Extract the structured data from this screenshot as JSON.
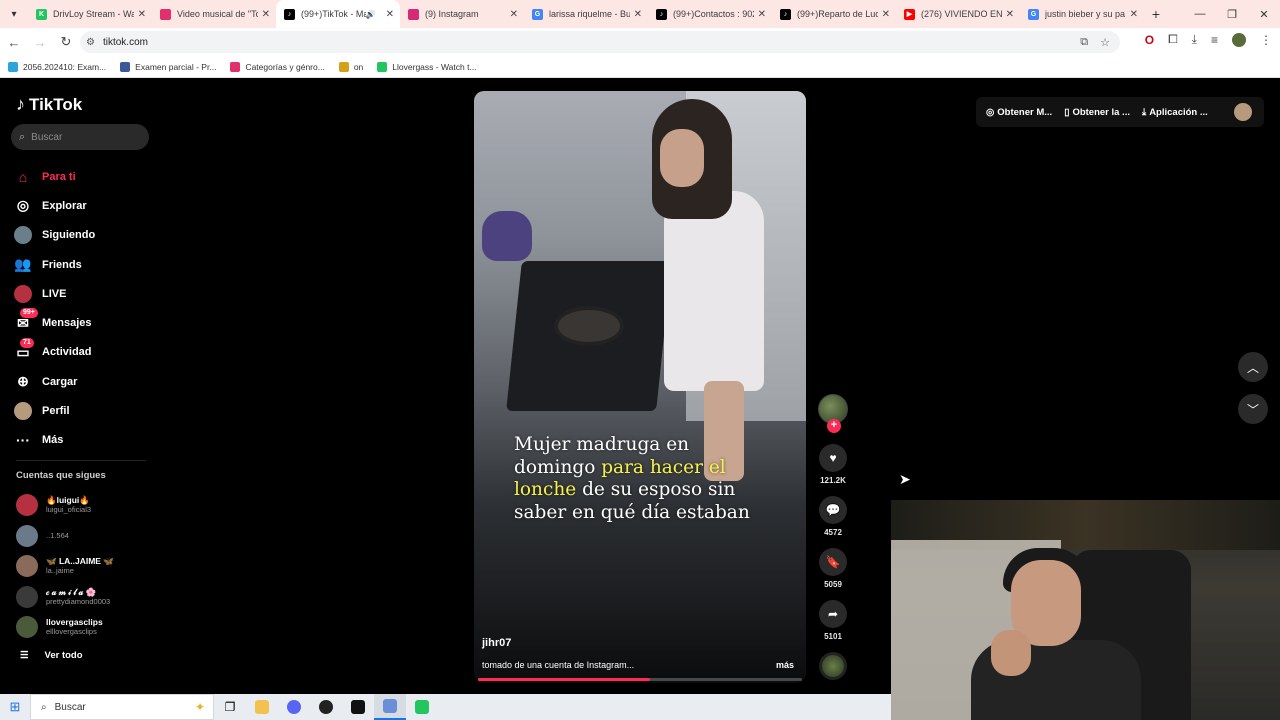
{
  "browser": {
    "tabs": [
      {
        "title": "DrivLoy Stream - Wat",
        "color": "#22c55e",
        "glyph": "K",
        "active": false
      },
      {
        "title": "Video musical de \"To",
        "color": "#e1306c",
        "glyph": "",
        "active": false
      },
      {
        "title": "(99+)TikTok - Ma",
        "color": "#000000",
        "glyph": "♪",
        "active": true,
        "audio": true
      },
      {
        "title": "(9) Instagram",
        "color": "#d62976",
        "glyph": "",
        "active": false
      },
      {
        "title": "larissa riquelme - Bus",
        "color": "#4285f4",
        "glyph": "G",
        "active": false
      },
      {
        "title": "(99+)Contactos : 902",
        "color": "#000000",
        "glyph": "♪",
        "active": false
      },
      {
        "title": "(99+)Reparto de Luc",
        "color": "#000000",
        "glyph": "♪",
        "active": false
      },
      {
        "title": "(276) VIVIENDO EN L",
        "color": "#ff0000",
        "glyph": "▶",
        "active": false
      },
      {
        "title": "justin bieber y su pa",
        "color": "#4285f4",
        "glyph": "G",
        "active": false
      }
    ],
    "url": "tiktok.com",
    "bookmarks": [
      {
        "label": "2056.202410: Exam...",
        "color": "#2aa4d9"
      },
      {
        "label": "Examen parcial - Pr...",
        "color": "#3b5998"
      },
      {
        "label": "Categorías y génro...",
        "color": "#e1306c"
      },
      {
        "label": "on",
        "color": "#d4a017"
      },
      {
        "label": "Llovergass - Watch t...",
        "color": "#22c55e"
      }
    ]
  },
  "tiktok": {
    "logo": "TikTok",
    "search_placeholder": "Buscar",
    "nav": [
      {
        "label": "Para ti",
        "icon": "home-icon",
        "active": true
      },
      {
        "label": "Explorar",
        "icon": "compass-icon"
      },
      {
        "label": "Siguiendo",
        "icon": "following-avatar"
      },
      {
        "label": "Friends",
        "icon": "friends-icon"
      },
      {
        "label": "LIVE",
        "icon": "live-avatar"
      },
      {
        "label": "Mensajes",
        "icon": "messages-icon",
        "badge": "99+"
      },
      {
        "label": "Actividad",
        "icon": "activity-icon",
        "badge": "71"
      },
      {
        "label": "Cargar",
        "icon": "upload-icon"
      },
      {
        "label": "Perfil",
        "icon": "profile-avatar"
      },
      {
        "label": "Más",
        "icon": "more-icon"
      }
    ],
    "following_title": "Cuentas que sigues",
    "accounts": [
      {
        "name": "🔥luigui🔥",
        "handle": "luigui_oficial3",
        "color": "#b5313f"
      },
      {
        "name": "",
        "handle": "..1.564",
        "color": "#6a7a8a"
      },
      {
        "name": "🦋 LA..JAIME 🦋",
        "handle": "la..jaime",
        "color": "#8a6a5a"
      },
      {
        "name": "𝒸 𝒶 𝓂 𝒾 𝓁 𝒶 🌸",
        "handle": "prettydiamond0003",
        "color": "#3a3a3a"
      },
      {
        "name": "llovergasclips",
        "handle": "elllovergasclips",
        "color": "#4a5a3a"
      }
    ],
    "see_all": "Ver todo",
    "top_actions": [
      "Obtener M...",
      "Obtener la ...",
      "Aplicación ..."
    ],
    "video": {
      "caption_line1": "Mujer madruga en",
      "caption_line2_a": "domingo ",
      "caption_line2_b": "para hacer el",
      "caption_line3_a": "lonche",
      "caption_line3_b": " de su esposo sin",
      "caption_line4": "saber en qué día estaban",
      "author": "jihr07",
      "description": "tomado de una cuenta de Instagram...",
      "more": "más",
      "progress": 0.53
    },
    "stats": {
      "likes": "121.2K",
      "comments": "4572",
      "saves": "5059",
      "shares": "5101"
    }
  },
  "taskbar": {
    "search": "Buscar"
  }
}
